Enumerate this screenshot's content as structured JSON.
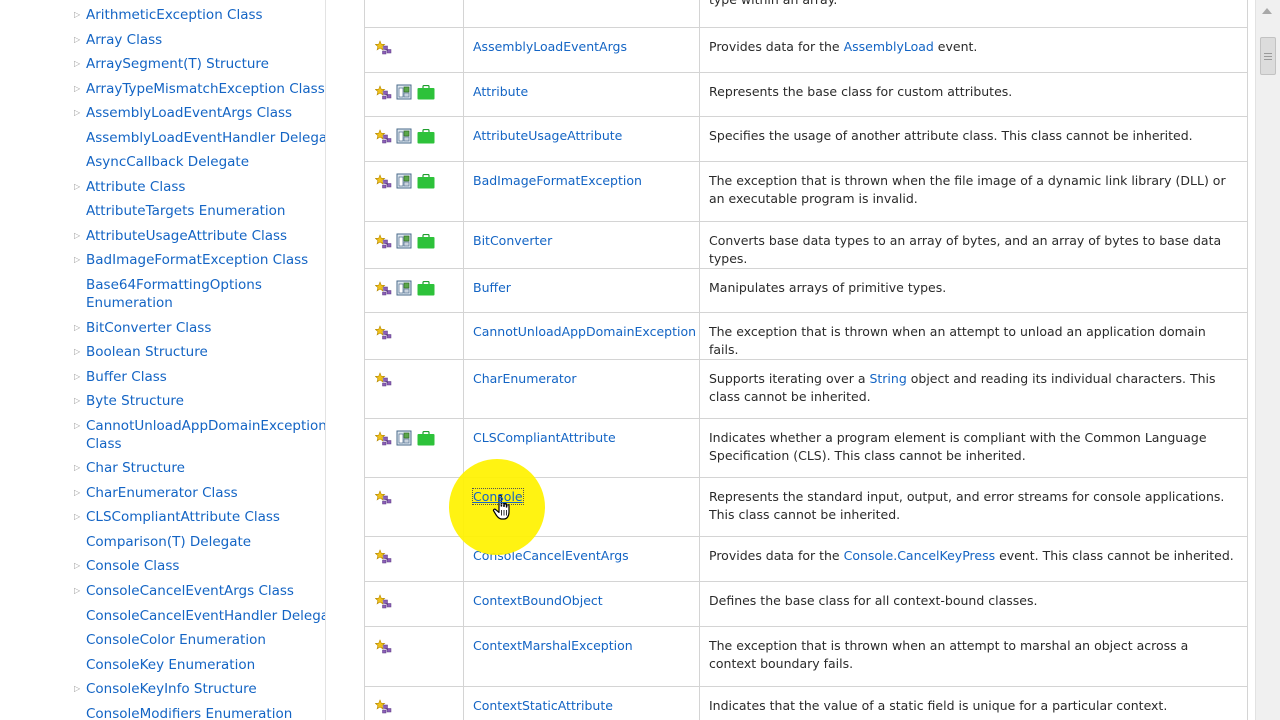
{
  "sidebar": {
    "items": [
      {
        "label": "ArithmeticException Class",
        "expandable": true
      },
      {
        "label": "Array Class",
        "expandable": true
      },
      {
        "label": "ArraySegment(T) Structure",
        "expandable": true
      },
      {
        "label": "ArrayTypeMismatchException Class",
        "expandable": true
      },
      {
        "label": "AssemblyLoadEventArgs Class",
        "expandable": true
      },
      {
        "label": "AssemblyLoadEventHandler Delegate",
        "expandable": false
      },
      {
        "label": "AsyncCallback Delegate",
        "expandable": false
      },
      {
        "label": "Attribute Class",
        "expandable": true
      },
      {
        "label": "AttributeTargets Enumeration",
        "expandable": false
      },
      {
        "label": "AttributeUsageAttribute Class",
        "expandable": true
      },
      {
        "label": "BadImageFormatException Class",
        "expandable": true
      },
      {
        "label": "Base64FormattingOptions Enumeration",
        "expandable": false,
        "wrap": true
      },
      {
        "label": "BitConverter Class",
        "expandable": true
      },
      {
        "label": "Boolean Structure",
        "expandable": true
      },
      {
        "label": "Buffer Class",
        "expandable": true
      },
      {
        "label": "Byte Structure",
        "expandable": true
      },
      {
        "label": "CannotUnloadAppDomainException Class",
        "expandable": true,
        "wrap": true
      },
      {
        "label": "Char Structure",
        "expandable": true
      },
      {
        "label": "CharEnumerator Class",
        "expandable": true
      },
      {
        "label": "CLSCompliantAttribute Class",
        "expandable": true
      },
      {
        "label": "Comparison(T) Delegate",
        "expandable": false
      },
      {
        "label": "Console Class",
        "expandable": true
      },
      {
        "label": "ConsoleCancelEventArgs Class",
        "expandable": true
      },
      {
        "label": "ConsoleCancelEventHandler Delegate",
        "expandable": false
      },
      {
        "label": "ConsoleColor Enumeration",
        "expandable": false
      },
      {
        "label": "ConsoleKey Enumeration",
        "expandable": false
      },
      {
        "label": "ConsoleKeyInfo Structure",
        "expandable": true
      },
      {
        "label": "ConsoleModifiers Enumeration",
        "expandable": false
      }
    ]
  },
  "table": {
    "rows": [
      {
        "name": "",
        "icons": [],
        "desc": [
          {
            "t": "type within an array."
          }
        ]
      },
      {
        "name": "AssemblyLoadEventArgs",
        "icons": [
          "class"
        ],
        "desc": [
          {
            "t": "Provides data for the "
          },
          {
            "t": "AssemblyLoad",
            "link": true
          },
          {
            "t": " event."
          }
        ]
      },
      {
        "name": "Attribute",
        "icons": [
          "class",
          "xna",
          "store"
        ],
        "desc": [
          {
            "t": "Represents the base class for custom attributes."
          }
        ]
      },
      {
        "name": "AttributeUsageAttribute",
        "icons": [
          "class",
          "xna",
          "store"
        ],
        "desc": [
          {
            "t": "Specifies the usage of another attribute class. This class cannot be inherited."
          }
        ]
      },
      {
        "name": "BadImageFormatException",
        "icons": [
          "class",
          "xna",
          "store"
        ],
        "desc": [
          {
            "t": "The exception that is thrown when the file image of a dynamic link library (DLL) or an executable program is invalid."
          }
        ]
      },
      {
        "name": "BitConverter",
        "icons": [
          "class",
          "xna",
          "store"
        ],
        "desc": [
          {
            "t": "Converts base data types to an array of bytes, and an array of bytes to base data types."
          }
        ]
      },
      {
        "name": "Buffer",
        "icons": [
          "class",
          "xna",
          "store"
        ],
        "desc": [
          {
            "t": "Manipulates arrays of primitive types."
          }
        ]
      },
      {
        "name": "CannotUnloadAppDomainException",
        "icons": [
          "class"
        ],
        "desc": [
          {
            "t": "The exception that is thrown when an attempt to unload an application domain fails."
          }
        ]
      },
      {
        "name": "CharEnumerator",
        "icons": [
          "class"
        ],
        "desc": [
          {
            "t": "Supports iterating over a "
          },
          {
            "t": "String",
            "link": true
          },
          {
            "t": " object and reading its individual characters. This class cannot be inherited."
          }
        ]
      },
      {
        "name": "CLSCompliantAttribute",
        "icons": [
          "class",
          "xna",
          "store"
        ],
        "desc": [
          {
            "t": "Indicates whether a program element is compliant with the Common Language Specification (CLS). This class cannot be inherited."
          }
        ]
      },
      {
        "name": "Console",
        "icons": [
          "class"
        ],
        "highlight": true,
        "desc": [
          {
            "t": "Represents the standard input, output, and error streams for console applications. This class cannot be inherited."
          }
        ]
      },
      {
        "name": "ConsoleCancelEventArgs",
        "icons": [
          "class"
        ],
        "desc": [
          {
            "t": "Provides data for the "
          },
          {
            "t": "Console.CancelKeyPress",
            "link": true
          },
          {
            "t": " event. This class cannot be inherited."
          }
        ]
      },
      {
        "name": "ContextBoundObject",
        "icons": [
          "class"
        ],
        "desc": [
          {
            "t": "Defines the base class for all context-bound classes."
          }
        ]
      },
      {
        "name": "ContextMarshalException",
        "icons": [
          "class"
        ],
        "desc": [
          {
            "t": "The exception that is thrown when an attempt to marshal an object across a context boundary fails."
          }
        ]
      },
      {
        "name": "ContextStaticAttribute",
        "icons": [
          "class"
        ],
        "desc": [
          {
            "t": "Indicates that the value of a static field is unique for a particular context."
          }
        ]
      }
    ]
  },
  "icons": {
    "class": "public-class-icon",
    "xna": "xna-framework-icon",
    "store": "portable-library-icon",
    "highlight_color": "#fff200",
    "link_color": "#1364c4"
  }
}
